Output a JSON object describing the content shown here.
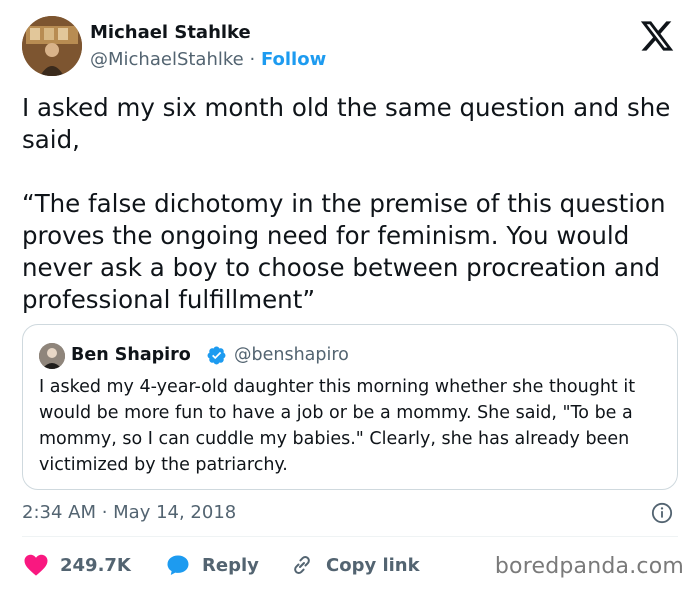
{
  "author": {
    "name": "Michael Stahlke",
    "handle": "@MichaelStahlke",
    "separator": "·",
    "follow_label": "Follow"
  },
  "tweet": {
    "paragraph1": "I asked my six month old the same question and she said,",
    "paragraph2": "“The false dichotomy in the premise of this question proves the ongoing need for feminism. You would never ask a boy to choose between procreation and professional fulfillment”"
  },
  "quote": {
    "name": "Ben Shapiro",
    "handle": "@benshapiro",
    "text": "I asked my 4-year-old daughter this morning whether she thought it would be more fun to have a job or be a mommy. She said, \"To be a mommy, so I can cuddle my babies.\" Clearly, she has already been victimized by the patriarchy."
  },
  "timestamp": "2:34 AM · May 14, 2018",
  "actions": {
    "like_count": "249.7K",
    "reply_label": "Reply",
    "copy_label": "Copy link"
  },
  "watermark": "boredpanda.com",
  "icons": {
    "brand": "x-logo-icon",
    "verified": "verified-badge-icon",
    "info": "info-icon",
    "like": "heart-icon",
    "reply": "speech-bubble-icon",
    "copy": "link-icon"
  },
  "colors": {
    "accent": "#1d9bf0",
    "like": "#f91880",
    "text": "#0f1419",
    "secondary": "#536471",
    "border": "#cfd9de"
  }
}
